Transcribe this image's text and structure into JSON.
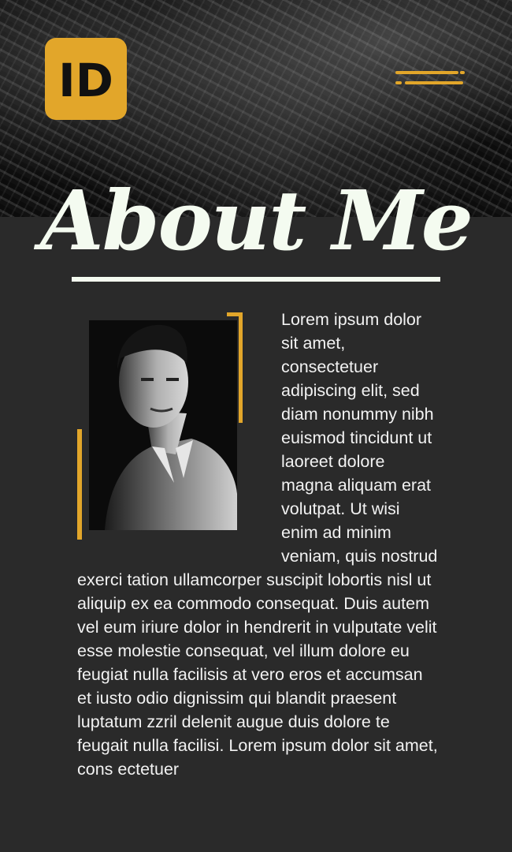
{
  "header": {
    "logo_label": "{ID}",
    "menu_icon": "hamburger-menu-icon"
  },
  "about": {
    "title": "About Me",
    "photo_alt": "Portrait of a man",
    "body": "Lorem ipsum dolor sit amet, consectetuer adipiscing elit, sed diam nonummy nibh euismod tincidunt ut laoreet dolore magna aliquam erat volutpat. Ut wisi enim ad minim veniam, quis nostrud exerci tation ullamcorper suscipit lobortis nisl ut aliquip ex ea commodo consequat. Duis autem vel eum iriure dolor in hendrerit in vulputate velit esse molestie consequat, vel illum dolore eu feugiat nulla facilisis at vero eros et accumsan et iusto odio dignissim qui blandit praesent luptatum zzril delenit augue duis dolore te feugait nulla facilisi. Lorem ipsum dolor sit amet, cons ectetuer"
  },
  "colors": {
    "accent": "#e2a62a",
    "background": "#2a2a2a",
    "title": "#f4fbf0"
  }
}
